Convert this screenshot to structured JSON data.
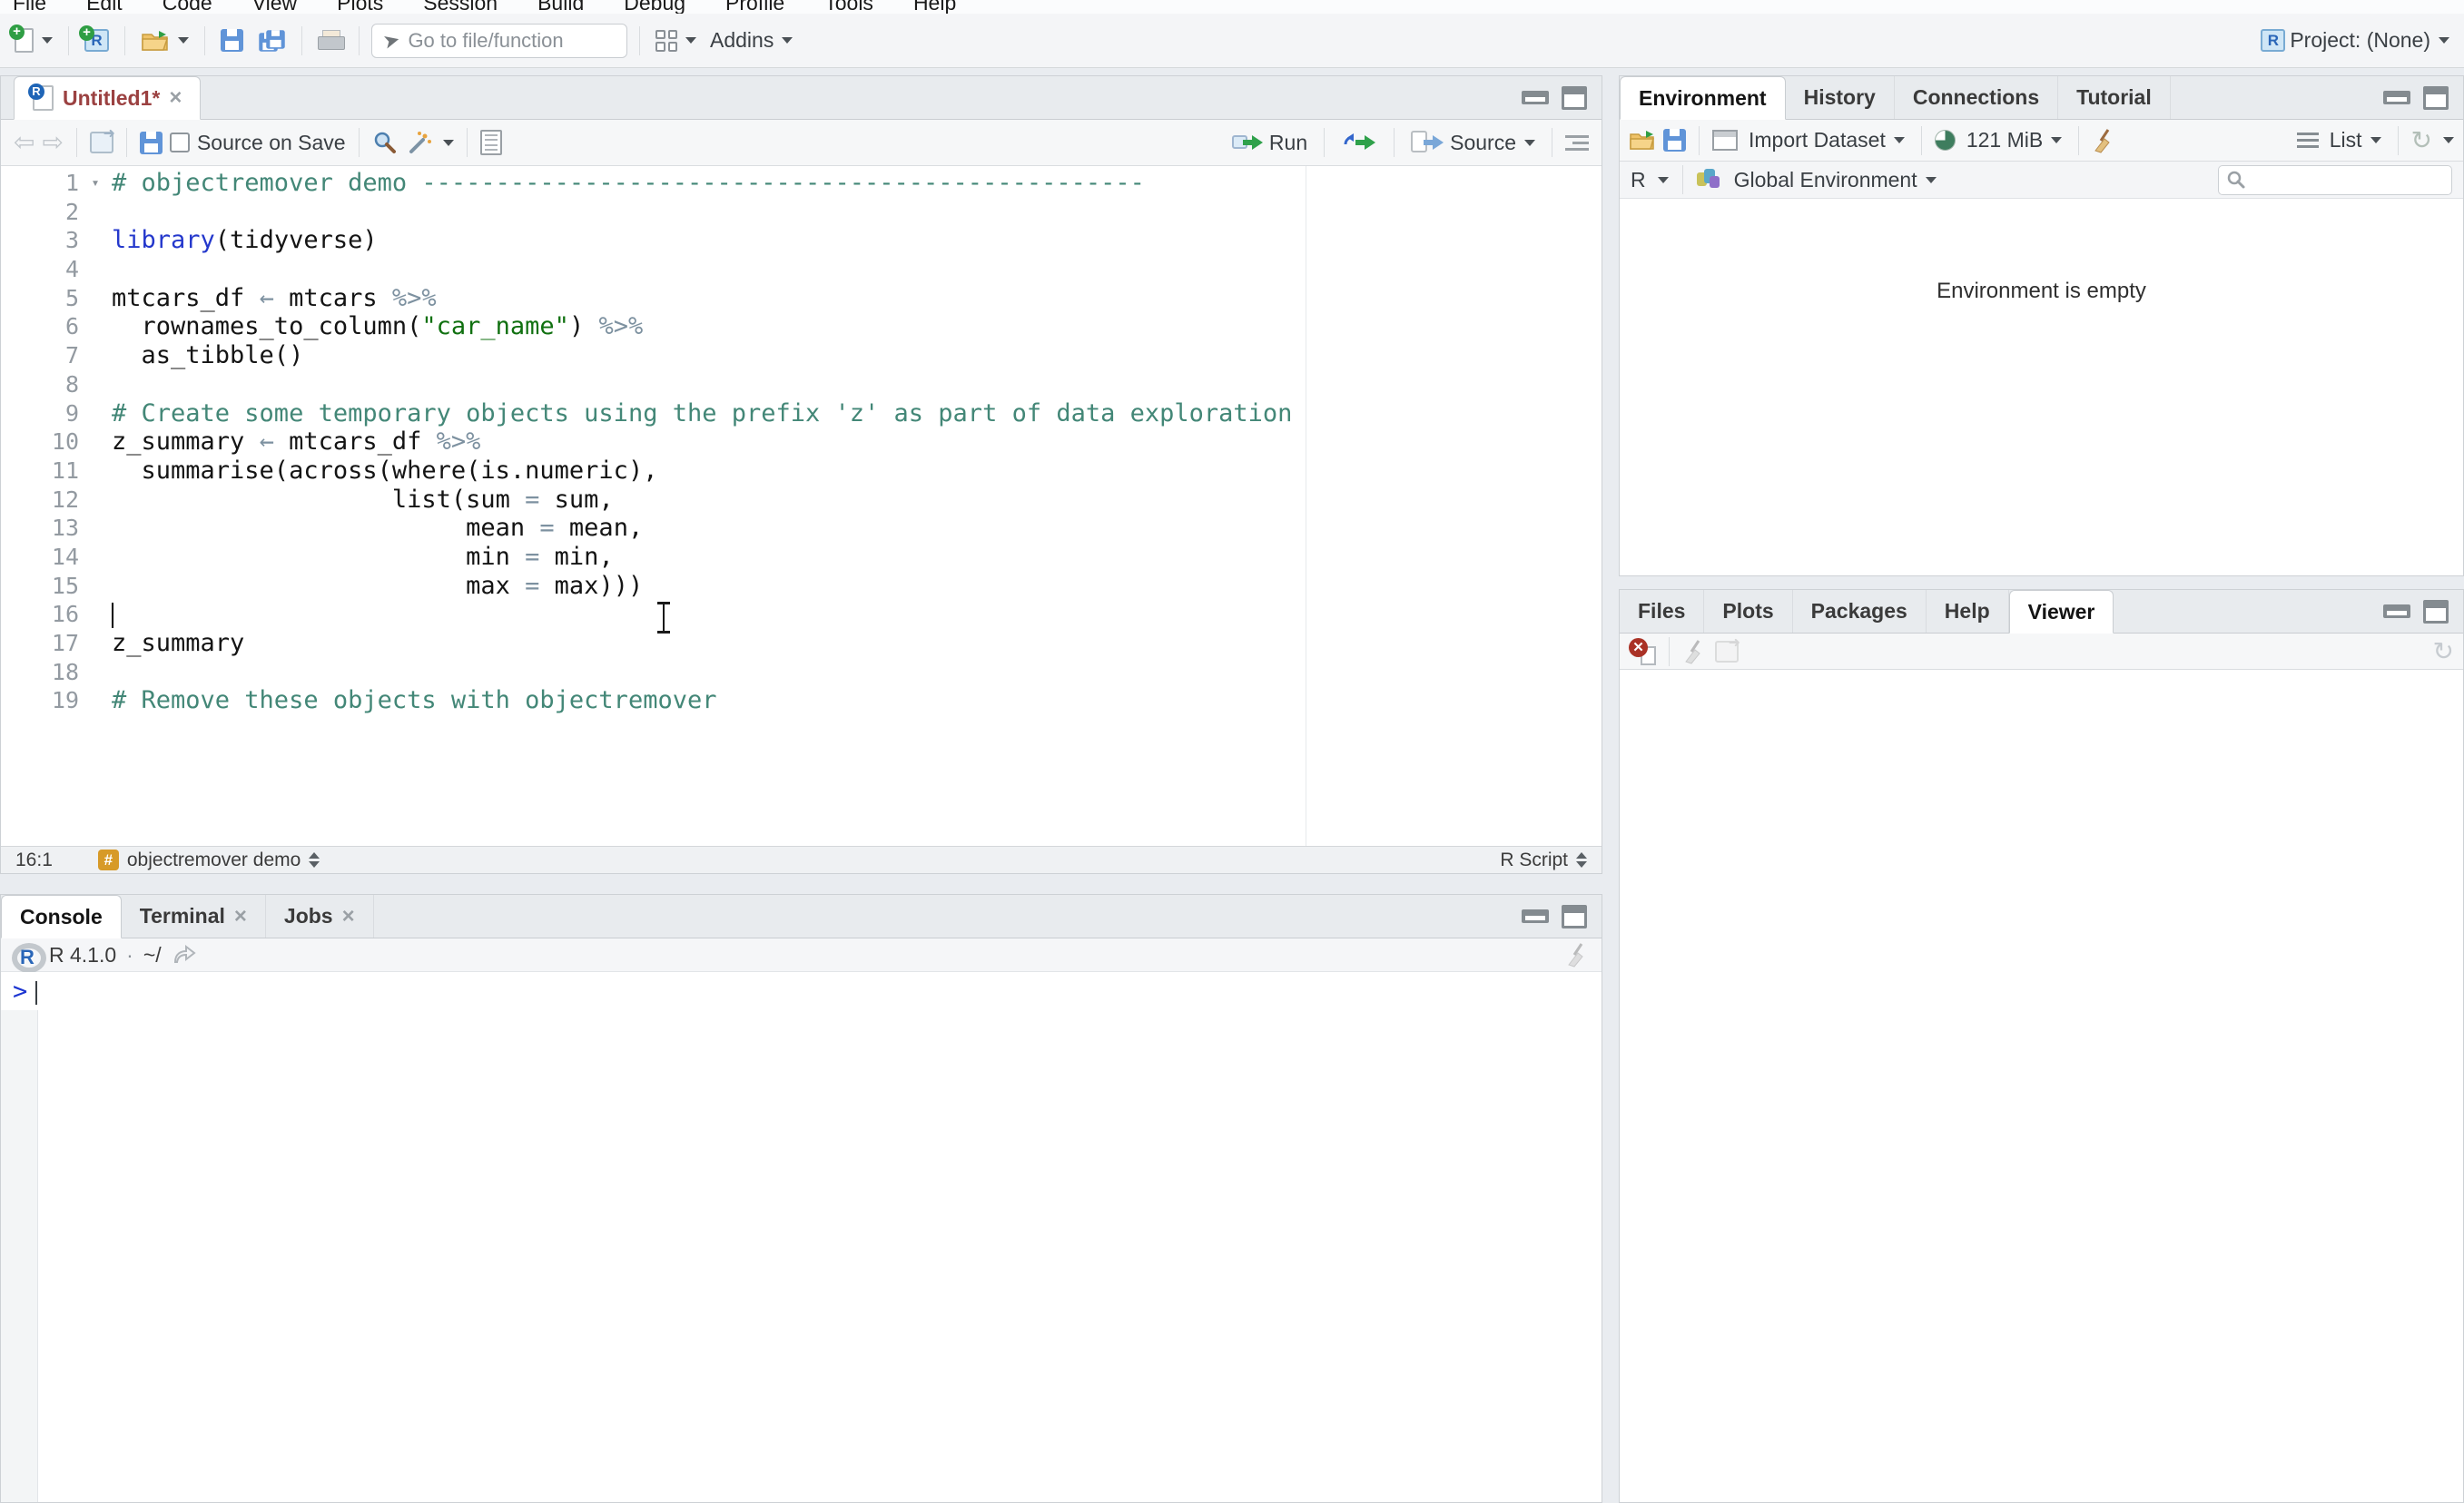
{
  "window": {
    "menu": [
      "File",
      "Edit",
      "Code",
      "View",
      "Plots",
      "Session",
      "Build",
      "Debug",
      "Profile",
      "Tools",
      "Help"
    ],
    "toolbar": {
      "goto_placeholder": "Go to file/function",
      "addins": "Addins",
      "project": "Project: (None)"
    }
  },
  "source_pane": {
    "tab_title": "Untitled1*",
    "tab_close": "×",
    "source_on_save": "Source on Save",
    "run": "Run",
    "source": "Source",
    "status": {
      "cursor": "16:1",
      "section_badge": "#",
      "section": "objectremover demo",
      "filetype": "R Script"
    },
    "fold_marker": "▾",
    "code_lines": [
      {
        "n": "1",
        "fold": true,
        "tokens": [
          [
            "com",
            "# objectremover demo -------------------------------------------------"
          ]
        ]
      },
      {
        "n": "2",
        "tokens": []
      },
      {
        "n": "3",
        "tokens": [
          [
            "fun",
            "library"
          ],
          [
            "txt",
            "(tidyverse)"
          ]
        ]
      },
      {
        "n": "4",
        "tokens": []
      },
      {
        "n": "5",
        "tokens": [
          [
            "txt",
            "mtcars_df "
          ],
          [
            "op",
            "← "
          ],
          [
            "txt",
            "mtcars "
          ],
          [
            "op",
            "%>%"
          ]
        ]
      },
      {
        "n": "6",
        "tokens": [
          [
            "txt",
            "  rownames_to_column("
          ],
          [
            "str",
            "\"car_name\""
          ],
          [
            "txt",
            ") "
          ],
          [
            "op",
            "%>%"
          ]
        ]
      },
      {
        "n": "7",
        "tokens": [
          [
            "txt",
            "  as_tibble()"
          ]
        ]
      },
      {
        "n": "8",
        "tokens": []
      },
      {
        "n": "9",
        "tokens": [
          [
            "com",
            "# Create some temporary objects using the prefix 'z' as part of data exploration"
          ]
        ]
      },
      {
        "n": "10",
        "tokens": [
          [
            "txt",
            "z_summary "
          ],
          [
            "op",
            "← "
          ],
          [
            "txt",
            "mtcars_df "
          ],
          [
            "op",
            "%>%"
          ]
        ]
      },
      {
        "n": "11",
        "tokens": [
          [
            "txt",
            "  summarise(across(where(is.numeric),"
          ]
        ]
      },
      {
        "n": "12",
        "tokens": [
          [
            "txt",
            "                   list(sum "
          ],
          [
            "op",
            "= "
          ],
          [
            "txt",
            "sum,"
          ]
        ]
      },
      {
        "n": "13",
        "tokens": [
          [
            "txt",
            "                        mean "
          ],
          [
            "op",
            "= "
          ],
          [
            "txt",
            "mean,"
          ]
        ]
      },
      {
        "n": "14",
        "tokens": [
          [
            "txt",
            "                        min "
          ],
          [
            "op",
            "= "
          ],
          [
            "txt",
            "min,"
          ]
        ]
      },
      {
        "n": "15",
        "tokens": [
          [
            "txt",
            "                        max "
          ],
          [
            "op",
            "= "
          ],
          [
            "txt",
            "max)))"
          ]
        ]
      },
      {
        "n": "16",
        "caret": true,
        "tokens": []
      },
      {
        "n": "17",
        "tokens": [
          [
            "txt",
            "z_summary"
          ]
        ]
      },
      {
        "n": "18",
        "tokens": []
      },
      {
        "n": "19",
        "tokens": [
          [
            "com",
            "# Remove these objects with objectremover"
          ]
        ]
      }
    ]
  },
  "console_pane": {
    "tabs": [
      {
        "label": "Console",
        "active": true
      },
      {
        "label": "Terminal",
        "closable": true
      },
      {
        "label": "Jobs",
        "closable": true
      }
    ],
    "r_version": "R 4.1.0",
    "dot": "·",
    "working_dir": "~/",
    "prompt": ">"
  },
  "environment_pane": {
    "tabs": [
      {
        "label": "Environment",
        "active": true
      },
      {
        "label": "History"
      },
      {
        "label": "Connections"
      },
      {
        "label": "Tutorial"
      }
    ],
    "import_dataset": "Import Dataset",
    "memory": "121 MiB",
    "view_mode": "List",
    "language": "R",
    "scope": "Global Environment",
    "empty_message": "Environment is empty"
  },
  "files_pane": {
    "tabs": [
      {
        "label": "Files"
      },
      {
        "label": "Plots"
      },
      {
        "label": "Packages"
      },
      {
        "label": "Help"
      },
      {
        "label": "Viewer",
        "active": true
      }
    ]
  },
  "colors": {
    "comment": "#438777",
    "function_blue": "#2438cc",
    "string_green": "#107010",
    "operator_slate": "#7d91a0",
    "prompt_blue": "#1c35d1",
    "modified_tab_title": "#9b4141",
    "section_badge_orange": "#d79a28"
  }
}
